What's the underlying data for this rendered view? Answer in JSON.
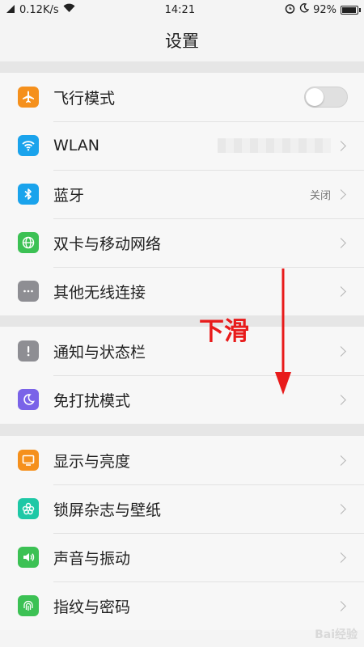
{
  "status_bar": {
    "network_speed": "0.12K/s",
    "time": "14:21",
    "battery": "92%"
  },
  "header": {
    "title": "设置"
  },
  "groups": [
    {
      "items": [
        {
          "label": "飞行模式",
          "icon": "airplane-icon",
          "color": "#f5901c",
          "control": "toggle"
        },
        {
          "label": "WLAN",
          "icon": "wifi-icon",
          "color": "#1aa3ec",
          "control": "chevron"
        },
        {
          "label": "蓝牙",
          "icon": "bluetooth-icon",
          "color": "#1aa3ec",
          "value": "关闭",
          "control": "chevron"
        },
        {
          "label": "双卡与移动网络",
          "icon": "globe-icon",
          "color": "#3cc154",
          "control": "chevron"
        },
        {
          "label": "其他无线连接",
          "icon": "more-icon",
          "color": "#8e8e93",
          "control": "chevron"
        }
      ]
    },
    {
      "items": [
        {
          "label": "通知与状态栏",
          "icon": "notification-icon",
          "color": "#8e8e93",
          "control": "chevron"
        },
        {
          "label": "免打扰模式",
          "icon": "moon-icon",
          "color": "#7a63e8",
          "control": "chevron"
        }
      ]
    },
    {
      "items": [
        {
          "label": "显示与亮度",
          "icon": "display-icon",
          "color": "#f5901c",
          "control": "chevron"
        },
        {
          "label": "锁屏杂志与壁纸",
          "icon": "flower-icon",
          "color": "#1ec8a6",
          "control": "chevron"
        },
        {
          "label": "声音与振动",
          "icon": "speaker-icon",
          "color": "#3cc154",
          "control": "chevron"
        },
        {
          "label": "指纹与密码",
          "icon": "fingerprint-icon",
          "color": "#3cc154",
          "control": "chevron"
        }
      ]
    }
  ],
  "annotation": {
    "text": "下滑",
    "color": "#e81b1b"
  },
  "watermark": {
    "text": "Bai经验"
  }
}
